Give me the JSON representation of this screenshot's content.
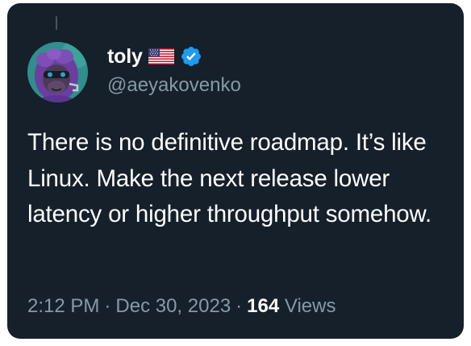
{
  "tweet": {
    "author_name": "toly",
    "handle": "@aeyakovenko",
    "text": "There is no definitive roadmap. It’s like Linux. Make the next release lower latency or higher throughput somehow.",
    "time": "2:12 PM",
    "date": "Dec 30, 2023",
    "separator": "·",
    "views_count": "164",
    "views_label": "Views",
    "verified": true
  },
  "icons": {
    "flag": "us-flag-icon",
    "verified": "verified-badge-icon",
    "avatar": "ape-avatar"
  },
  "colors": {
    "background": "#15202b",
    "primary_text": "#ffffff",
    "secondary_text": "#8899a6",
    "verified_blue": "#1d9bf0"
  }
}
